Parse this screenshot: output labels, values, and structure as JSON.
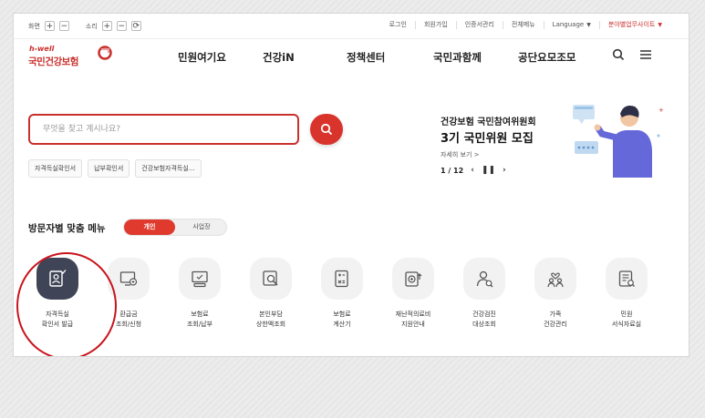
{
  "util": {
    "screen_label": "화면",
    "sound_label": "소리",
    "plus": "+",
    "minus": "−",
    "reset": "⟳",
    "links": [
      "로그인",
      "회원가입",
      "인증서관리",
      "전체메뉴",
      "Language",
      "분야별업무사이트"
    ]
  },
  "logo": {
    "small": "h-well",
    "main": "국민건강보험"
  },
  "gnb": [
    "민원여기요",
    "건강iN",
    "정책센터",
    "국민과함께",
    "공단요모조모"
  ],
  "search": {
    "placeholder": "무엇을 찾고 계시나요?",
    "chips": [
      "자격득실확인서",
      "납부확인서",
      "건강보험자격득실..."
    ]
  },
  "banner": {
    "subtitle": "건강보험 국민참여위원회",
    "title": "3기 국민위원 모집",
    "more": "자세히 보기 >",
    "pager": "1 / 12"
  },
  "visitor": {
    "title": "방문자별 맞춤 메뉴",
    "toggle": [
      "개인",
      "사업장"
    ]
  },
  "menu": [
    {
      "icon": "id-card-icon",
      "line1": "자격득실",
      "line2": "확인서 발급"
    },
    {
      "icon": "monitor-refund-icon",
      "line1": "환급금",
      "line2": "조회/신청"
    },
    {
      "icon": "payment-screen-icon",
      "line1": "보험료",
      "line2": "조회/납부"
    },
    {
      "icon": "magnify-doc-icon",
      "line1": "본인부담",
      "line2": "상한액조회"
    },
    {
      "icon": "calculator-icon",
      "line1": "보험료",
      "line2": "계산기"
    },
    {
      "icon": "medical-support-icon",
      "line1": "재난적의료비",
      "line2": "지원안내"
    },
    {
      "icon": "checkup-person-icon",
      "line1": "건강검진",
      "line2": "대상조회"
    },
    {
      "icon": "family-icon",
      "line1": "가족",
      "line2": "건강관리"
    },
    {
      "icon": "form-doc-icon",
      "line1": "민원",
      "line2": "서식자료실"
    }
  ],
  "colors": {
    "brand_red": "#c9302c",
    "active_dark": "#3f4556",
    "toggle_on": "#e03a2e"
  }
}
